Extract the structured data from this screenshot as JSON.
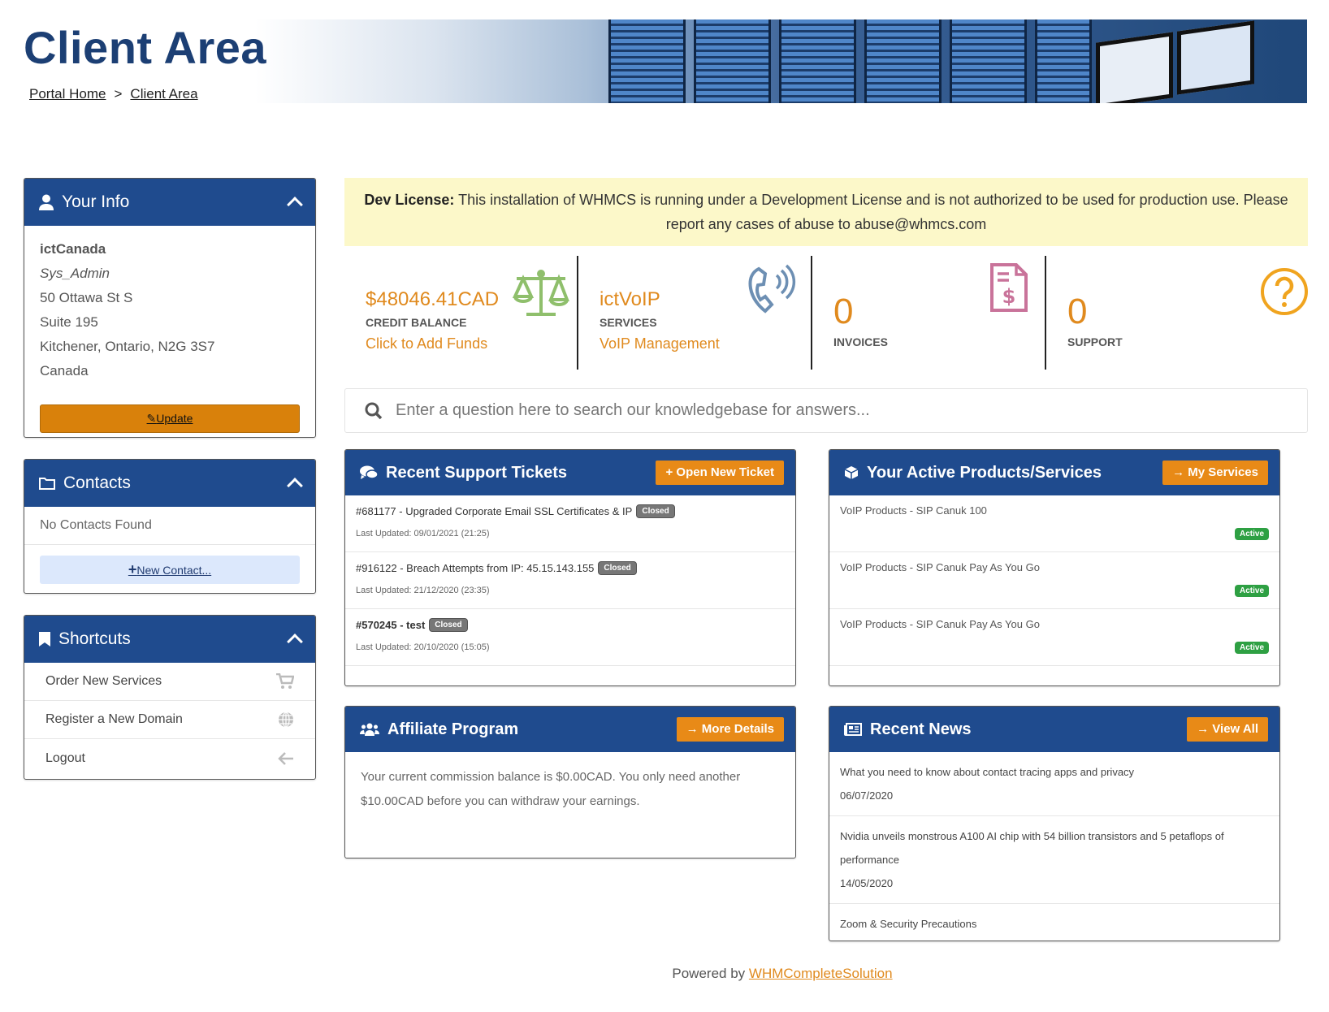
{
  "header": {
    "title": "Client Area",
    "breadcrumb": {
      "home": "Portal Home",
      "sep": ">",
      "current": "Client Area"
    }
  },
  "your_info": {
    "title": "Your Info",
    "company": "ictCanada",
    "role": "Sys_Admin",
    "address1": "50 Ottawa St S",
    "address2": "Suite 195",
    "city": "Kitchener, Ontario, N2G 3S7",
    "country": "Canada",
    "update_label": "Update"
  },
  "contacts": {
    "title": "Contacts",
    "empty": "No Contacts Found",
    "new_label": "New Contact..."
  },
  "shortcuts": {
    "title": "Shortcuts",
    "items": [
      {
        "label": "Order New Services",
        "icon": "cart-icon"
      },
      {
        "label": "Register a New Domain",
        "icon": "globe-icon"
      },
      {
        "label": "Logout",
        "icon": "arrow-left-icon"
      }
    ]
  },
  "alert": {
    "strong": "Dev License:",
    "text": "This installation of WHMCS is running under a Development License and is not authorized to be used for production use. Please report any cases of abuse to abuse@whmcs.com"
  },
  "stats": [
    {
      "value": "$48046.41CAD",
      "label": "CREDIT BALANCE",
      "link": "Click to Add Funds",
      "icon": "scale-icon",
      "icon_color": "#8fbf6c"
    },
    {
      "value": "ictVoIP",
      "label": "SERVICES",
      "link": "VoIP Management",
      "icon": "phone-icon",
      "icon_color": "#6d8fb3"
    },
    {
      "value": "0",
      "label": "INVOICES",
      "icon": "invoice-icon",
      "icon_color": "#c9739a"
    },
    {
      "value": "0",
      "label": "SUPPORT",
      "icon": "question-icon",
      "icon_color": "#f0a41f"
    }
  ],
  "search": {
    "placeholder": "Enter a question here to search our knowledgebase for answers..."
  },
  "tickets": {
    "title": "Recent Support Tickets",
    "button": "Open New Ticket",
    "items": [
      {
        "title": "#681177 - Upgraded Corporate Email SSL Certificates & IP",
        "status": "Closed",
        "updated": "Last Updated: 09/01/2021 (21:25)"
      },
      {
        "title": "#916122 - Breach Attempts from IP: 45.15.143.155",
        "status": "Closed",
        "updated": "Last Updated: 21/12/2020 (23:35)"
      },
      {
        "title": "#570245 - test",
        "status": "Closed",
        "updated": "Last Updated: 20/10/2020 (15:05)"
      }
    ]
  },
  "services": {
    "title": "Your Active Products/Services",
    "button": "My Services",
    "items": [
      {
        "name": "VoIP Products - SIP Canuk 100",
        "status": "Active"
      },
      {
        "name": "VoIP Products - SIP Canuk Pay As You Go",
        "status": "Active"
      },
      {
        "name": "VoIP Products - SIP Canuk Pay As You Go",
        "status": "Active"
      }
    ]
  },
  "affiliate": {
    "title": "Affiliate Program",
    "button": "More Details",
    "text": "Your current commission balance is $0.00CAD. You only need another $10.00CAD before you can withdraw your earnings."
  },
  "news": {
    "title": "Recent News",
    "button": "View All",
    "items": [
      {
        "title": "What you need to know about contact tracing apps and privacy",
        "date": "06/07/2020"
      },
      {
        "title": "Nvidia unveils monstrous A100 AI chip with 54 billion transistors and 5 petaflops of performance",
        "date": "14/05/2020"
      },
      {
        "title": "Zoom & Security Precautions",
        "date": ""
      }
    ]
  },
  "footer": {
    "prefix": "Powered by",
    "link": "WHMCompleteSolution"
  }
}
